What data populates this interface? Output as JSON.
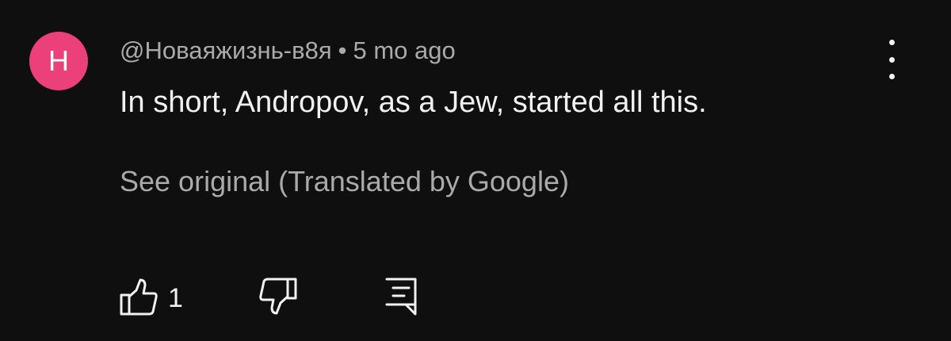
{
  "comment": {
    "avatar_letter": "H",
    "avatar_color": "#ec407a",
    "author": "@Новаяжизнь-в8я",
    "separator": "•",
    "timestamp": "5 mo ago",
    "text": "In short, Andropov, as a Jew, started all this.",
    "see_original": "See original (Translated by Google)",
    "menu_icon": "more-vert-icon"
  },
  "actions": {
    "like_icon": "thumb-up-icon",
    "like_count": "1",
    "dislike_icon": "thumb-down-icon",
    "reply_icon": "comment-reply-icon"
  },
  "colors": {
    "background": "#0f0f0f",
    "primary_text": "#f1f1f1",
    "secondary_text": "#aaaaaa"
  }
}
